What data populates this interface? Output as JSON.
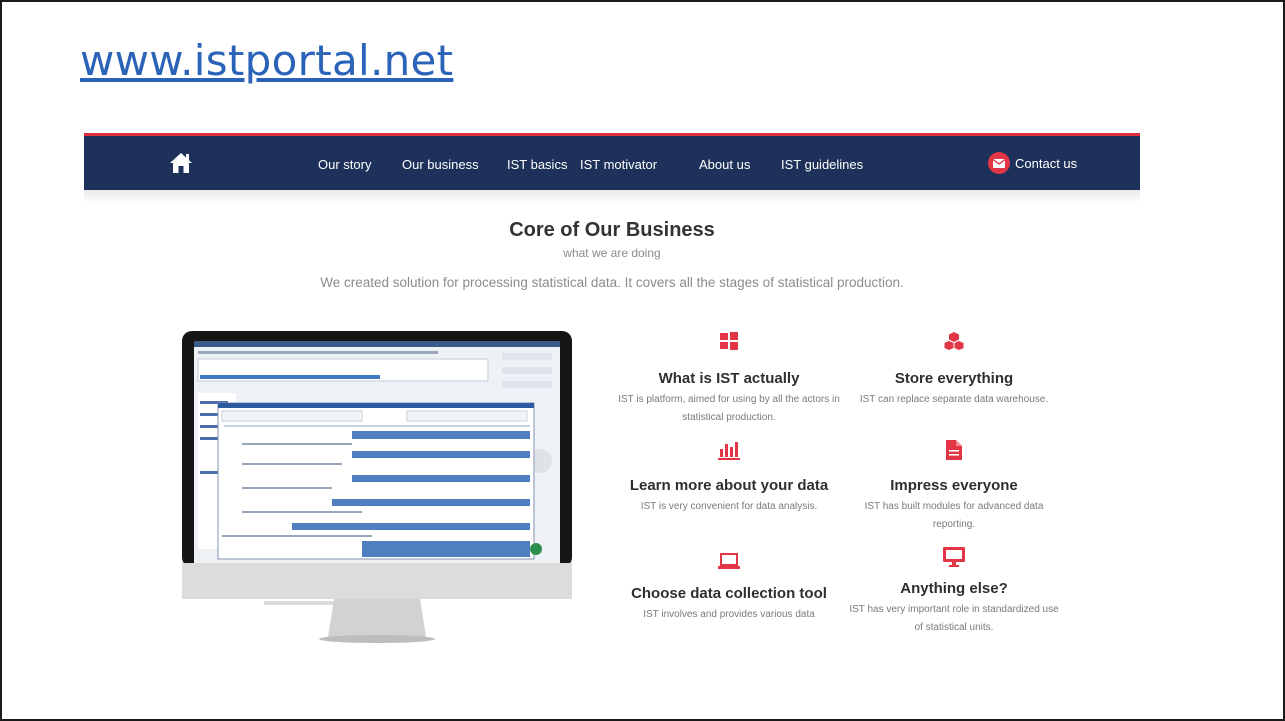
{
  "slide": {
    "title": "www.istportal.net"
  },
  "nav": {
    "items": [
      "Our story",
      "Our business",
      "IST basics",
      "IST motivator",
      "About us",
      "IST guidelines"
    ],
    "contact_label": "Contact us"
  },
  "section": {
    "title": "Core of Our Business",
    "subtitle": "what we are doing",
    "description": "We created solution for processing statistical data. It covers all the stages of statistical production."
  },
  "features": [
    {
      "icon": "windows-icon",
      "title": "What is IST actually",
      "text": "IST is platform, aimed for using by all the actors in statistical production."
    },
    {
      "icon": "cubes-icon",
      "title": "Store everything",
      "text": "IST can replace separate data warehouse."
    },
    {
      "icon": "bar-chart-icon",
      "title": "Learn more about your data",
      "text": "IST is very convenient for data analysis."
    },
    {
      "icon": "document-icon",
      "title": "Impress everyone",
      "text": "IST has built modules for advanced data reporting."
    },
    {
      "icon": "laptop-icon",
      "title": "Choose data collection tool",
      "text": "IST involves and provides various data"
    },
    {
      "icon": "monitor-icon",
      "title": "Anything else?",
      "text": "IST has very important role in standardized use of statistical units."
    }
  ],
  "colors": {
    "navbar": "#1e315a",
    "accent": "#e23545",
    "link": "#2a63b8"
  }
}
